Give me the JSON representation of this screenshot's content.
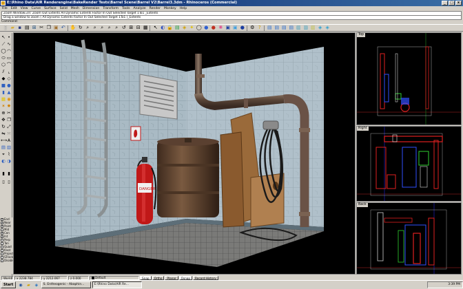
{
  "window": {
    "title": "E:\\Rhino Data\\AIR Renderengine\\BakeRender Tests\\Barrel Scene\\Barrel V2\\Barrel3.3dm - Rhinoceros (Commercial)",
    "min": "_",
    "max": "□",
    "close": "x"
  },
  "menu": [
    "File",
    "Edit",
    "View",
    "Curve",
    "Surface",
    "Solid",
    "Mesh",
    "Dimension",
    "Transform",
    "Tools",
    "Analyze",
    "Render",
    "Monkey",
    "Help"
  ],
  "command": {
    "history": "Zoom Window=In: Zoom Out Extents All Dynamic Extents Factor In Out Selected Target 1To1 _Extents",
    "line2": "Drag a window to zoom ( All Dynamic Extents Factor In Out Selected Target 1To1 )_Extents",
    "prompt": "Command:"
  },
  "viewports": {
    "perspective": {
      "label": ""
    },
    "top": {
      "label": "Top"
    },
    "right": {
      "label": "Right"
    },
    "back": {
      "label": "Back"
    }
  },
  "scene": {
    "danger_label": "DANGER"
  },
  "osnap": {
    "items": [
      {
        "label": "End",
        "checked": true
      },
      {
        "label": "Near",
        "checked": true
      },
      {
        "label": "Point",
        "checked": true
      },
      {
        "label": "Mid",
        "checked": false
      },
      {
        "label": "Cen",
        "checked": true
      },
      {
        "label": "Int",
        "checked": true
      },
      {
        "label": "Perp",
        "checked": false
      },
      {
        "label": "Tan",
        "checked": false
      },
      {
        "label": "Quad",
        "checked": false
      },
      {
        "label": "Knot",
        "checked": false
      },
      {
        "label": "Project",
        "checked": false
      },
      {
        "label": "STrack",
        "checked": false
      },
      {
        "label": "Disable",
        "checked": false
      }
    ]
  },
  "status": {
    "cplane": "World",
    "x": "x 2238.784",
    "y": "y 2212.067",
    "z": "z 0.000",
    "layer": "Default",
    "snap": "Snap",
    "ortho": "Ortho",
    "planar": "Planar",
    "osnap": "Osnap",
    "record": "Record History"
  },
  "taskbar": {
    "start": "Start",
    "tasks": [
      "S. Entheogenic - Abaphin...",
      "E:\\Rhino Data\\AIR Re..."
    ],
    "clock": "3:39 PM"
  },
  "colors": {
    "titlebar": "#0a246a",
    "wall": "#9fb3bf",
    "pipe": "#7a5f50",
    "barrel": "#6b4a35",
    "wood": "#9a6a3a",
    "extinguisher": "#c01818"
  }
}
